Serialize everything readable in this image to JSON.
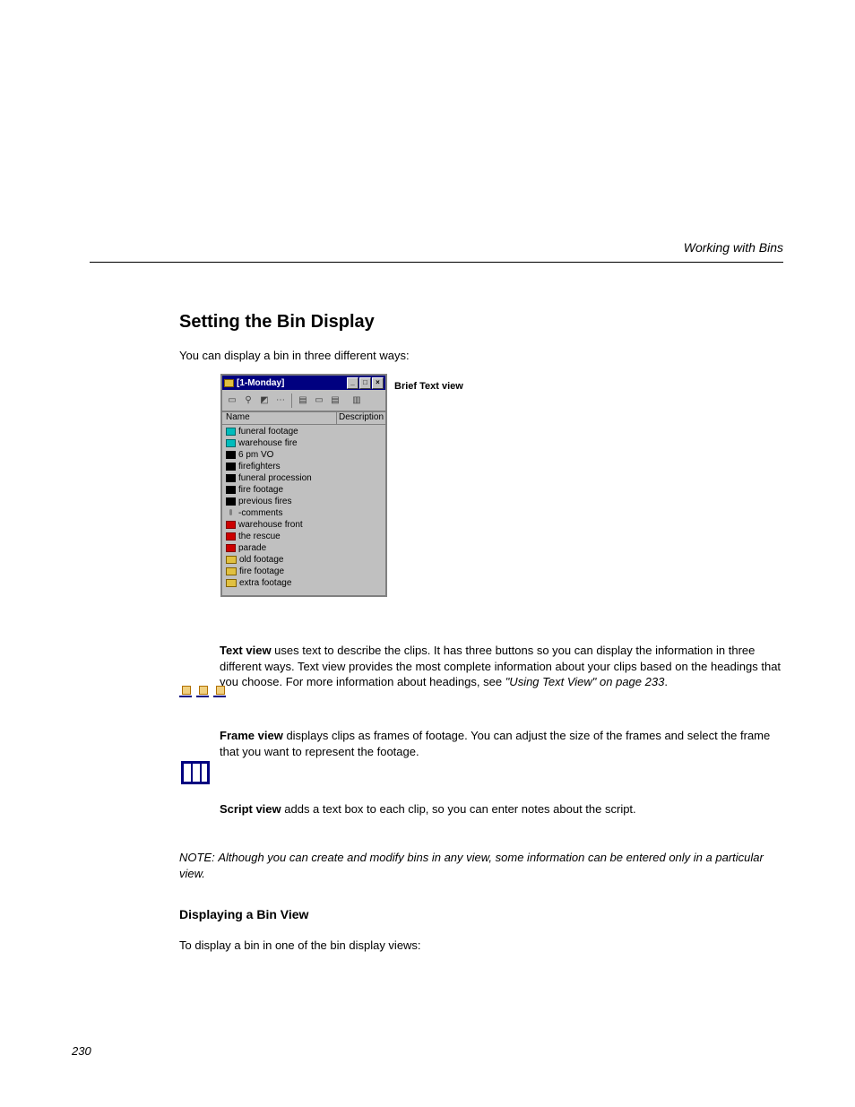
{
  "header": {
    "running": "Working with Bins"
  },
  "section": {
    "heading": "Setting the Bin Display",
    "intro": "You can display a bin in three different ways:"
  },
  "bin_window": {
    "title": "[1-Monday]",
    "columns": {
      "name": "Name",
      "desc": "Description"
    },
    "items": [
      {
        "icon": "clip-cyan",
        "label": "funeral footage"
      },
      {
        "icon": "clip-cyan",
        "label": "warehouse fire"
      },
      {
        "icon": "clip-black",
        "label": "6 pm VO"
      },
      {
        "icon": "clip-black",
        "label": "firefighters"
      },
      {
        "icon": "clip-black",
        "label": "funeral procession"
      },
      {
        "icon": "clip-black",
        "label": "fire footage"
      },
      {
        "icon": "clip-black",
        "label": "previous fires"
      },
      {
        "icon": "mic",
        "label": "-comments"
      },
      {
        "icon": "clip-red",
        "label": "warehouse front"
      },
      {
        "icon": "clip-red",
        "label": "the rescue"
      },
      {
        "icon": "clip-red",
        "label": "parade"
      },
      {
        "icon": "folder",
        "label": "old footage"
      },
      {
        "icon": "folder",
        "label": "fire footage"
      },
      {
        "icon": "folder",
        "label": "extra footage"
      }
    ]
  },
  "caption": "Brief Text view",
  "text_view": {
    "bullet_label": "Text view",
    "para1_a": " uses text to describe the clips. It has three buttons so you can display the information in three different ways. Text view provides the most complete information about your clips based on the headings that you choose. For more information about headings, see ",
    "para1_link": "\"Using Text View\" on page 233",
    "para1_b": "."
  },
  "frame_view": {
    "bullet_label": "Frame view",
    "para": " displays clips as frames of footage. You can adjust the size of the frames and select the frame that you want to represent the footage."
  },
  "script_view": {
    "bullet_label": "Script view",
    "para": " adds a text box to each clip, so you can enter notes about the script."
  },
  "note": {
    "label": "NOTE:",
    "body": " Although you can create and modify bins in any view, some information can be entered only in a particular view."
  },
  "sub_heading": "Displaying a Bin View",
  "howto_para": "To display a bin in one of the bin display views:",
  "page_number": "230"
}
